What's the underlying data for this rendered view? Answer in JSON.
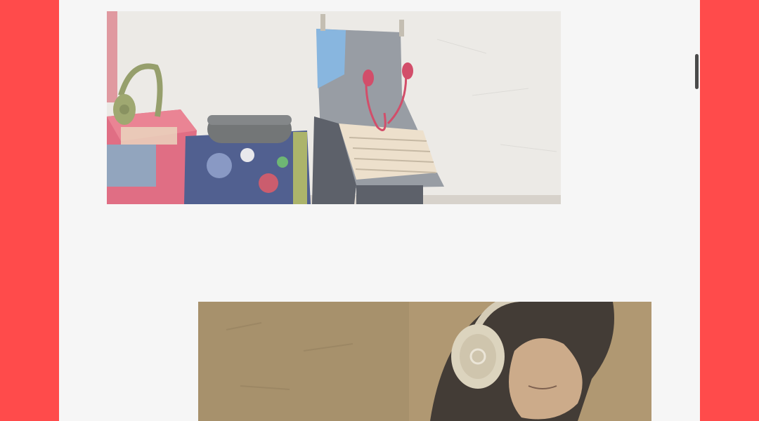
{
  "theme": {
    "outer_background": "#ff4b4b",
    "page_background": "#f6f6f6",
    "scrollbar_thumb": "#4a4a4a"
  },
  "gallery": {
    "photos": [
      {
        "subject": "beats-products-on-art-boxes"
      },
      {
        "subject": "woman-wearing-gold-headphones"
      }
    ]
  },
  "scrollbar": {
    "position_fraction": 0.14
  }
}
